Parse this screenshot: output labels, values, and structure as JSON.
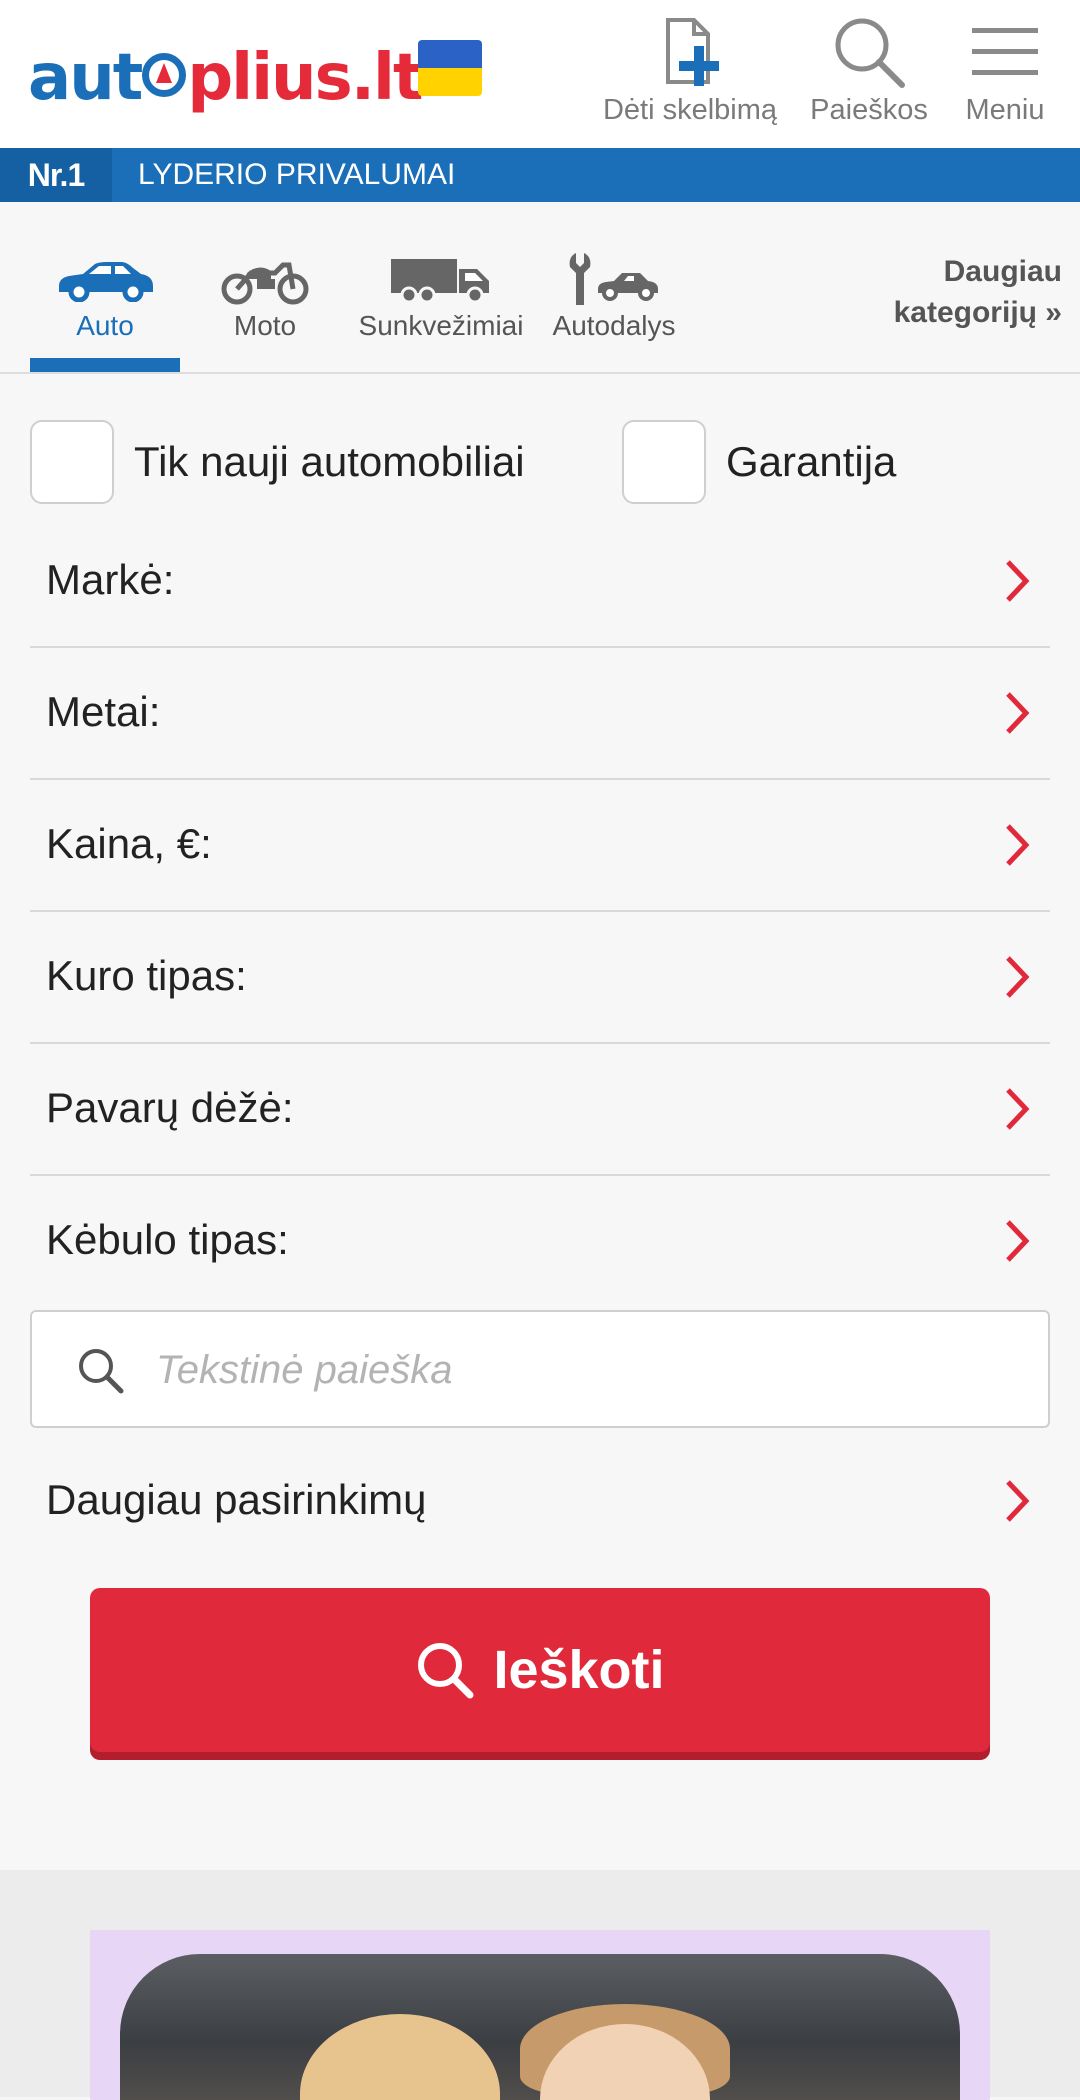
{
  "header": {
    "logo_part1": "aut",
    "logo_part2": "plius.lt",
    "post_ad_label": "Dėti skelbimą",
    "searches_label": "Paieškos",
    "menu_label": "Meniu"
  },
  "leader_bar": {
    "badge": "Nr.1",
    "text": "LYDERIO PRIVALUMAI"
  },
  "categories": {
    "items": [
      {
        "label": "Auto",
        "icon": "car-icon",
        "active": true
      },
      {
        "label": "Moto",
        "icon": "motorcycle-icon",
        "active": false
      },
      {
        "label": "Sunkvežimiai",
        "icon": "truck-icon",
        "active": false
      },
      {
        "label": "Autodalys",
        "icon": "wrench-car-icon",
        "active": false
      }
    ],
    "more_line1": "Daugiau",
    "more_line2": "kategorijų »"
  },
  "filters": {
    "checkbox_new": "Tik nauji automobiliai",
    "checkbox_warranty": "Garantija",
    "rows": [
      {
        "label": "Markė:"
      },
      {
        "label": "Metai:"
      },
      {
        "label": "Kaina, €:"
      },
      {
        "label": "Kuro tipas:"
      },
      {
        "label": "Pavarų dėžė:"
      },
      {
        "label": "Kėbulo tipas:"
      }
    ],
    "text_search_placeholder": "Tekstinė paieška",
    "more_options": "Daugiau pasirinkimų",
    "search_button": "Ieškoti"
  },
  "colors": {
    "brand_blue": "#1a6fb8",
    "brand_red": "#e0293a"
  }
}
